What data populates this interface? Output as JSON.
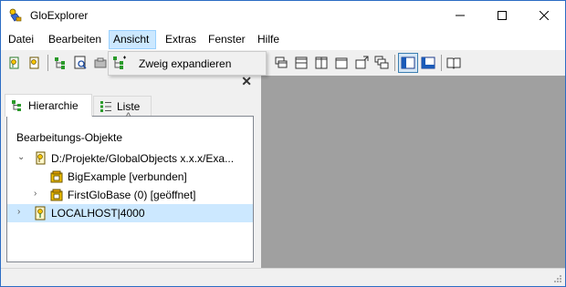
{
  "window": {
    "title": "GloExplorer"
  },
  "menubar": {
    "items": [
      "Datei",
      "Bearbeiten",
      "Ansicht",
      "Extras",
      "Fenster",
      "Hilfe"
    ],
    "active": "Ansicht"
  },
  "dropdown": {
    "items": [
      {
        "label": "Zweig expandieren",
        "icon": "expand-branch-icon"
      }
    ]
  },
  "panel": {
    "tabs": [
      {
        "label": "Hierarchie",
        "icon": "hierarchy-icon",
        "selected": true
      },
      {
        "label": "Liste",
        "icon": "list-icon",
        "selected": false
      }
    ],
    "tree": {
      "header": "Bearbeitungs-Objekte",
      "nodes": [
        {
          "label": "D:/Projekte/GlobalObjects x.x.x/Exa...",
          "expanded": true
        },
        {
          "label": "BigExample [verbunden]",
          "expanded": false
        },
        {
          "label": "FirstGloBase (0) [geöffnet]",
          "expanded": false
        },
        {
          "label": "LOCALHOST|4000",
          "expanded": false,
          "selected": true
        }
      ]
    }
  },
  "colors": {
    "selection": "#cce8ff",
    "mdi_background": "#a0a0a0",
    "window_border": "#2b6cc4"
  }
}
